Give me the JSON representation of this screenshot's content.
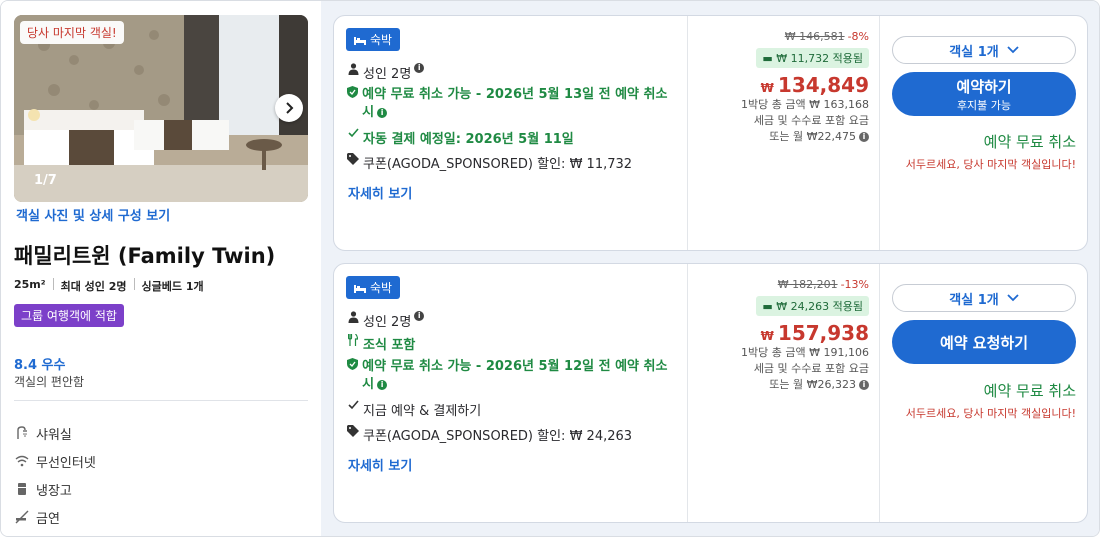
{
  "room": {
    "last_room_badge": "당사 마지막 객실!",
    "photo_counter": "1/7",
    "photo_link": "객실 사진 및 상세 구성 보기",
    "title": "패밀리트윈 (Family Twin)",
    "specs": [
      "25m²",
      "최대 성인 2명",
      "싱글베드 1개"
    ],
    "group_badge": "그룹 여행객에 적합",
    "score": "8.4 우수",
    "score_sub": "객실의 편안함",
    "amenities": [
      {
        "label": "샤워실",
        "icon": "shower-icon"
      },
      {
        "label": "무선인터넷",
        "icon": "wifi-icon"
      },
      {
        "label": "냉장고",
        "icon": "fridge-icon"
      },
      {
        "label": "금연",
        "icon": "no-smoking-icon"
      }
    ]
  },
  "offers": [
    {
      "stay_badge": "숙박",
      "guests": "성인 2명",
      "cancel_text": "예약 무료 취소 가능 - 2026년 5월 13일 전 예약 취소 시",
      "payment_text": "자동 결제 예정일: 2026년 5월 11일",
      "coupon_text": "쿠폰(AGODA_SPONSORED) 할인: ₩ 11,732",
      "detail_link": "자세히 보기",
      "original_price": "₩ 146,581",
      "discount_pct": "-8%",
      "applied": "₩ 11,732 적용됨",
      "currency": "₩",
      "final_price": "134,849",
      "total_line": "1박당 총 금액 ₩ 163,168",
      "tax_line": "세금 및 수수료 포함 요금",
      "monthly_line": "또는 월 ₩22,475",
      "room_select": "객실 1개",
      "book_label": "예약하기",
      "book_sub": "후지불 가능",
      "free_cancel": "예약 무료 취소",
      "hurry": "서두르세요, 당사 마지막 객실입니다!"
    },
    {
      "stay_badge": "숙박",
      "guests": "성인 2명",
      "breakfast": "조식 포함",
      "cancel_text": "예약 무료 취소 가능 - 2026년 5월 12일 전 예약 취소 시",
      "payment_text": "지금 예약 & 결제하기",
      "coupon_text": "쿠폰(AGODA_SPONSORED) 할인: ₩ 24,263",
      "detail_link": "자세히 보기",
      "original_price": "₩ 182,201",
      "discount_pct": "-13%",
      "applied": "₩ 24,263 적용됨",
      "currency": "₩",
      "final_price": "157,938",
      "total_line": "1박당 총 금액 ₩ 191,106",
      "tax_line": "세금 및 수수료 포함 요금",
      "monthly_line": "또는 월 ₩26,323",
      "room_select": "객실 1개",
      "book_label": "예약 요청하기",
      "free_cancel": "예약 무료 취소",
      "hurry": "서두르세요, 당사 마지막 객실입니다!"
    }
  ],
  "colors": {
    "accent": "#1f6ad1",
    "price_red": "#c7382e",
    "green": "#1f8a43",
    "purple": "#7c40c9"
  }
}
